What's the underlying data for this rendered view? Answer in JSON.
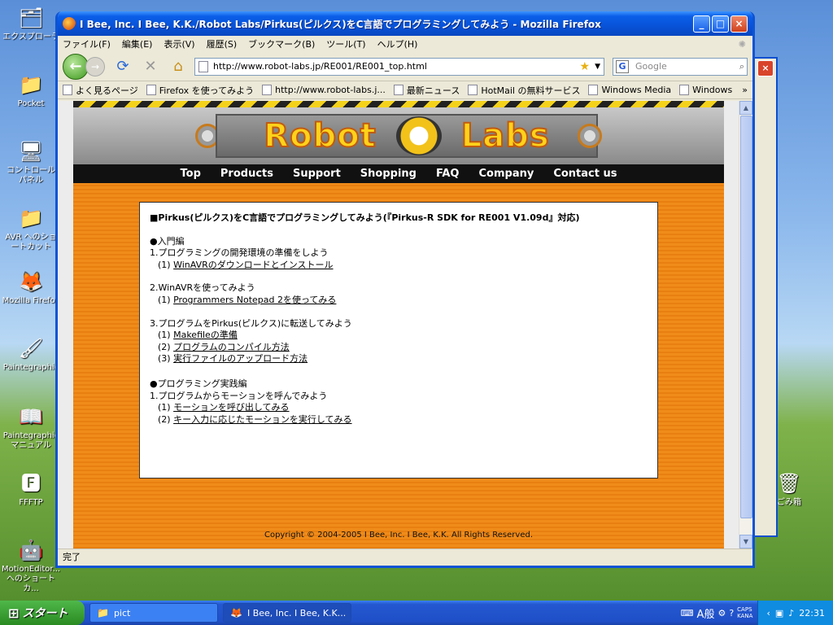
{
  "desktop": {
    "icons": [
      {
        "label": "エクスプローラ",
        "glyph": "🗂"
      },
      {
        "label": "Pocket",
        "glyph": "📁"
      },
      {
        "label": "コントロール パネル",
        "glyph": "🖥"
      },
      {
        "label": "AVR へのショートカット",
        "glyph": "📁"
      },
      {
        "label": "Mozilla Firefox",
        "glyph": "🦊"
      },
      {
        "label": "Paintegraphic",
        "glyph": "🖌"
      },
      {
        "label": "Paintegraphic マニュアル",
        "glyph": "📖"
      },
      {
        "label": "FFFTP",
        "glyph": "🅵"
      },
      {
        "label": "MotionEditor... へのショートカ...",
        "glyph": "🤖"
      }
    ],
    "recycle_bin": {
      "label": "ごみ箱",
      "glyph": "🗑"
    }
  },
  "window": {
    "title": "I Bee, Inc. I Bee, K.K./Robot Labs/Pirkus(ピルクス)をC言語でプログラミングしてみよう - Mozilla Firefox",
    "menu": [
      "ファイル(F)",
      "編集(E)",
      "表示(V)",
      "履歴(S)",
      "ブックマーク(B)",
      "ツール(T)",
      "ヘルプ(H)"
    ],
    "url": "http://www.robot-labs.jp/RE001/RE001_top.html",
    "search_placeholder": "Google",
    "bookmarks": [
      "よく見るページ",
      "Firefox を使ってみよう",
      "http://www.robot-labs.j...",
      "最新ニュース",
      "HotMail の無料サービス",
      "Windows Media",
      "Windows"
    ],
    "bookmarks_more": "»",
    "status": "完了"
  },
  "site": {
    "logo_left": "Robot",
    "logo_right": "Labs",
    "nav": [
      "Top",
      "Products",
      "Support",
      "Shopping",
      "FAQ",
      "Company",
      "Contact us"
    ],
    "heading": "■Pirkus(ピルクス)をC言語でプログラミングしてみよう(『Pirkus-R SDK for RE001 V1.09d』対応)",
    "sections": [
      {
        "title": "●入門編",
        "groups": [
          {
            "title": "1.プログラミングの開発環境の準備をしよう",
            "links": [
              {
                "num": "(1)",
                "text": "WinAVRのダウンロードとインストール"
              }
            ]
          },
          {
            "title": "2.WinAVRを使ってみよう",
            "links": [
              {
                "num": "(1)",
                "text": "Programmers Notepad 2を使ってみる"
              }
            ]
          },
          {
            "title": "3.プログラムをPirkus(ピルクス)に転送してみよう",
            "links": [
              {
                "num": "(1)",
                "text": "Makefileの準備"
              },
              {
                "num": "(2)",
                "text": "プログラムのコンパイル方法"
              },
              {
                "num": "(3)",
                "text": "実行ファイルのアップロード方法"
              }
            ]
          }
        ]
      },
      {
        "title": "●プログラミング実践編",
        "groups": [
          {
            "title": "1.プログラムからモーションを呼んでみよう",
            "links": [
              {
                "num": "(1)",
                "text": "モーションを呼び出してみる"
              },
              {
                "num": "(2)",
                "text": "キー入力に応じたモーションを実行してみる"
              }
            ]
          }
        ]
      }
    ],
    "copyright": "Copyright © 2004-2005 I Bee, Inc. I Bee, K.K. All Rights Reserved."
  },
  "taskbar": {
    "start": "スタート",
    "tasks": [
      {
        "label": "pict",
        "icon": "📁"
      },
      {
        "label": "I Bee, Inc. I Bee, K.K...",
        "icon": "🦊"
      }
    ],
    "ime": "A般",
    "caps": "CAPS",
    "kana": "KANA",
    "clock": "22:31"
  }
}
